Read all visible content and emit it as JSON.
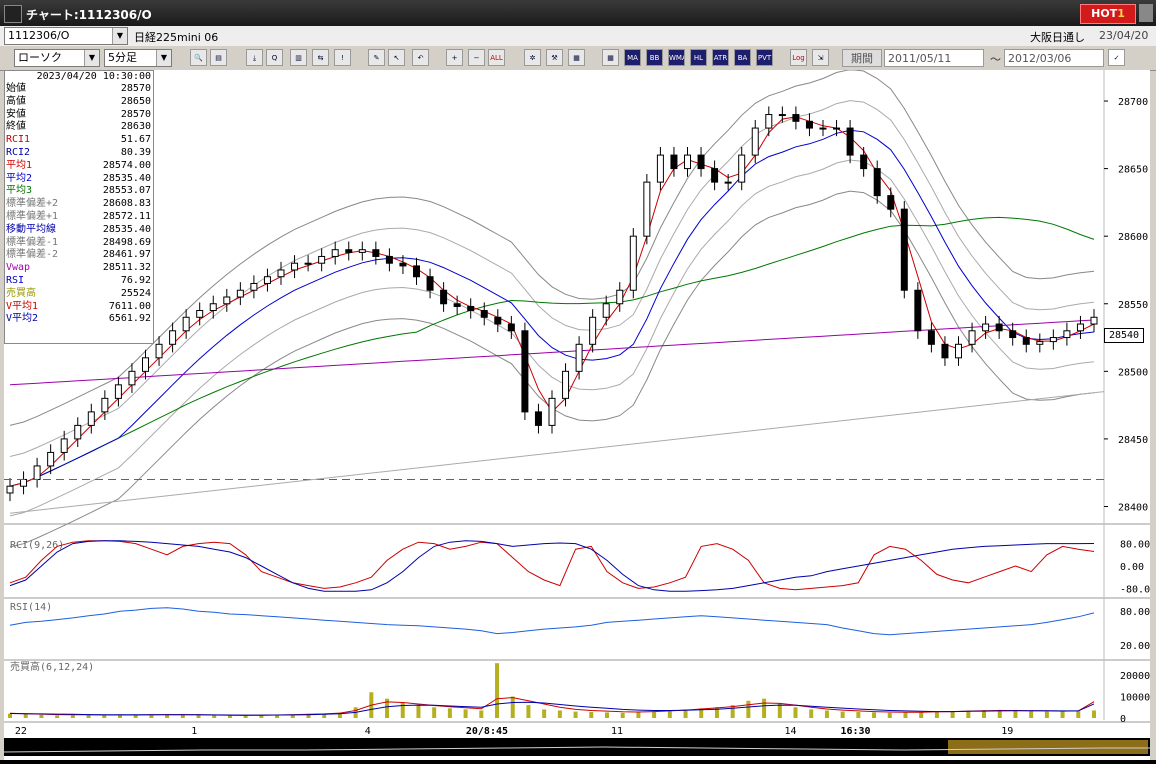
{
  "window": {
    "title": "チャート:1112306/O",
    "hot_label": "HOT",
    "hot_number": "1"
  },
  "symbol_bar": {
    "symbol_value": "1112306/O",
    "instrument_name": "日経225mini 06",
    "session": "大阪日通し",
    "date": "23/04/20"
  },
  "toolbar": {
    "chart_type": "ローソク",
    "interval": "5分足",
    "period_button": "期間",
    "date_from": "2011/05/11",
    "range_sep": "〜",
    "date_to": "2012/03/06",
    "tool_labels": [
      "MA",
      "BB",
      "WMA",
      "HL",
      "ATR",
      "BA",
      "PVT",
      "Log",
      "ALL"
    ]
  },
  "info_panel": {
    "datetime": "2023/04/20  10:30:00",
    "rows": [
      {
        "label": "始値",
        "value": "28570",
        "color": "#000000"
      },
      {
        "label": "高値",
        "value": "28650",
        "color": "#000000"
      },
      {
        "label": "安値",
        "value": "28570",
        "color": "#000000"
      },
      {
        "label": "終値",
        "value": "28630",
        "color": "#000000"
      },
      {
        "label": "RCI1",
        "value": "51.67",
        "color": "#cc0000"
      },
      {
        "label": "RCI2",
        "value": "80.39",
        "color": "#0000aa"
      },
      {
        "label": "平均1",
        "value": "28574.00",
        "color": "#cc0000"
      },
      {
        "label": "平均2",
        "value": "28535.40",
        "color": "#0000cc"
      },
      {
        "label": "平均3",
        "value": "28553.07",
        "color": "#007700"
      },
      {
        "label": "標準偏差+2",
        "value": "28608.83",
        "color": "#777777"
      },
      {
        "label": "標準偏差+1",
        "value": "28572.11",
        "color": "#777777"
      },
      {
        "label": "移動平均線",
        "value": "28535.40",
        "color": "#0000aa"
      },
      {
        "label": "標準偏差-1",
        "value": "28498.69",
        "color": "#777777"
      },
      {
        "label": "標準偏差-2",
        "value": "28461.97",
        "color": "#777777"
      },
      {
        "label": "Vwap",
        "value": "28511.32",
        "color": "#aa00aa"
      },
      {
        "label": "RSI",
        "value": "76.92",
        "color": "#0000cc"
      },
      {
        "label": "売買高",
        "value": "25524",
        "color": "#999900"
      },
      {
        "label": "V平均1",
        "value": "7611.00",
        "color": "#cc0000"
      },
      {
        "label": "V平均2",
        "value": "6561.92",
        "color": "#0000aa"
      }
    ]
  },
  "current_price": "28540",
  "chart_data": [
    {
      "type": "candlestick",
      "y_ticks": [
        "28700",
        "28650",
        "28600",
        "28550",
        "28500",
        "28450",
        "28400"
      ],
      "ylim": [
        28390,
        28720
      ],
      "x_ticks": [
        "22",
        "1",
        "4",
        "20/8:45",
        "11",
        "14",
        "16:30",
        "19"
      ],
      "notes": "5-minute candlestick chart with MA, Bollinger bands, VWAP",
      "close": [
        28415,
        28420,
        28430,
        28440,
        28450,
        28460,
        28470,
        28480,
        28490,
        28500,
        28510,
        28520,
        28530,
        28540,
        28545,
        28550,
        28555,
        28560,
        28565,
        28570,
        28575,
        28580,
        28580,
        28585,
        28590,
        28588,
        28590,
        28585,
        28580,
        28578,
        28570,
        28560,
        28550,
        28548,
        28545,
        28540,
        28535,
        28530,
        28470,
        28460,
        28480,
        28500,
        28520,
        28540,
        28550,
        28560,
        28600,
        28640,
        28660,
        28650,
        28660,
        28650,
        28640,
        28640,
        28660,
        28680,
        28690,
        28690,
        28685,
        28680,
        28680,
        28680,
        28660,
        28650,
        28630,
        28620,
        28560,
        28530,
        28520,
        28510,
        28520,
        28530,
        28535,
        28530,
        28525,
        28520,
        28522,
        28525,
        28530,
        28535,
        28540
      ]
    },
    {
      "type": "line",
      "title": "RCI(9,26)",
      "y_ticks": [
        "80.00",
        "0.00",
        "-80.00"
      ],
      "ylim": [
        -100,
        100
      ],
      "series": [
        {
          "name": "RCI1",
          "color": "#cc0000",
          "values": [
            -60,
            -40,
            20,
            70,
            85,
            90,
            90,
            88,
            80,
            60,
            40,
            70,
            80,
            85,
            80,
            40,
            -20,
            -40,
            -60,
            -70,
            -80,
            -75,
            -60,
            -40,
            20,
            60,
            85,
            80,
            60,
            70,
            85,
            80,
            30,
            -20,
            -50,
            -70,
            60,
            70,
            -20,
            -60,
            -80,
            -75,
            -60,
            -40,
            70,
            80,
            60,
            20,
            -60,
            -80,
            -85,
            -80,
            -75,
            -70,
            -60,
            40,
            70,
            60,
            20,
            -30,
            -50,
            -60,
            -40,
            -20,
            0,
            -20,
            40,
            70,
            60,
            51.67
          ]
        },
        {
          "name": "RCI2",
          "color": "#0000aa",
          "values": [
            -70,
            -50,
            0,
            50,
            80,
            88,
            90,
            90,
            88,
            85,
            80,
            75,
            70,
            60,
            50,
            30,
            0,
            -30,
            -60,
            -80,
            -90,
            -90,
            -90,
            -85,
            -60,
            -20,
            30,
            70,
            85,
            90,
            88,
            80,
            70,
            75,
            80,
            82,
            80,
            60,
            20,
            -30,
            -70,
            -85,
            -90,
            -90,
            -88,
            -85,
            -80,
            -70,
            -60,
            -50,
            -40,
            -35,
            -20,
            -10,
            0,
            10,
            20,
            30,
            40,
            50,
            60,
            65,
            70,
            72,
            75,
            78,
            80,
            80,
            80,
            80.39
          ]
        }
      ]
    },
    {
      "type": "line",
      "title": "RSI(14)",
      "y_ticks": [
        "80.00",
        "20.00"
      ],
      "ylim": [
        0,
        100
      ],
      "series": [
        {
          "name": "RSI",
          "color": "#1d5fe0",
          "values": [
            55,
            60,
            62,
            65,
            68,
            72,
            75,
            80,
            82,
            85,
            86,
            84,
            80,
            78,
            75,
            74,
            72,
            70,
            68,
            66,
            64,
            62,
            60,
            58,
            56,
            55,
            54,
            52,
            50,
            48,
            45,
            40,
            42,
            45,
            48,
            50,
            52,
            55,
            60,
            62,
            64,
            66,
            68,
            70,
            72,
            70,
            68,
            66,
            64,
            62,
            60,
            58,
            56,
            50,
            45,
            40,
            38,
            40,
            42,
            44,
            46,
            48,
            50,
            52,
            54,
            56,
            60,
            65,
            70,
            76.92
          ]
        }
      ]
    },
    {
      "type": "bar",
      "title": "売買高(6,12,24)",
      "y_ticks": [
        "20000",
        "10000",
        "0"
      ],
      "ylim": [
        0,
        27000
      ],
      "series": [
        {
          "name": "売買高",
          "color": "#b6b020",
          "values": [
            2000,
            1800,
            1500,
            1200,
            1300,
            1600,
            1400,
            1200,
            1300,
            1500,
            1700,
            1600,
            1400,
            1300,
            1200,
            1100,
            1300,
            1400,
            1600,
            1800,
            2000,
            2500,
            5000,
            12000,
            9000,
            7000,
            6000,
            5000,
            4500,
            4000,
            3500,
            25524,
            10000,
            6000,
            4000,
            3500,
            3000,
            2800,
            2600,
            2400,
            2600,
            3000,
            3500,
            4000,
            4500,
            5000,
            6000,
            8000,
            9000,
            7000,
            5000,
            4000,
            3500,
            3000,
            2800,
            2600,
            2400,
            2500,
            2700,
            3000,
            3200,
            3400,
            3600,
            3800,
            3500,
            3200,
            3000,
            3000,
            3200,
            3500
          ]
        },
        {
          "name": "V平均1",
          "color": "#cc0000",
          "values": [
            2200,
            2000,
            1800,
            1600,
            1500,
            1500,
            1400,
            1400,
            1400,
            1500,
            1600,
            1600,
            1500,
            1400,
            1300,
            1200,
            1300,
            1400,
            1500,
            1700,
            1900,
            2300,
            3500,
            6000,
            7500,
            7200,
            6500,
            5800,
            5200,
            4800,
            4300,
            9000,
            9500,
            8000,
            6500,
            5000,
            4000,
            3500,
            3200,
            2900,
            2800,
            3000,
            3300,
            3700,
            4200,
            4700,
            5300,
            6200,
            7000,
            6800,
            6000,
            5000,
            4200,
            3700,
            3300,
            3000,
            2800,
            2700,
            2700,
            2900,
            3000,
            3200,
            3400,
            3500,
            3500,
            3400,
            3300,
            3200,
            3300,
            7611
          ]
        },
        {
          "name": "V平均2",
          "color": "#0000aa",
          "values": [
            2100,
            2000,
            1900,
            1800,
            1700,
            1600,
            1550,
            1500,
            1500,
            1500,
            1550,
            1550,
            1500,
            1450,
            1400,
            1350,
            1350,
            1400,
            1450,
            1550,
            1700,
            1950,
            2600,
            4000,
            5200,
            5800,
            6000,
            5900,
            5600,
            5300,
            5000,
            6500,
            7200,
            7300,
            7000,
            6300,
            5600,
            5000,
            4500,
            4000,
            3700,
            3500,
            3500,
            3600,
            3800,
            4100,
            4500,
            5100,
            5700,
            6000,
            5900,
            5500,
            5000,
            4600,
            4200,
            3800,
            3500,
            3300,
            3100,
            3000,
            3000,
            3100,
            3200,
            3300,
            3400,
            3400,
            3400,
            3300,
            3300,
            6562
          ]
        }
      ]
    }
  ]
}
